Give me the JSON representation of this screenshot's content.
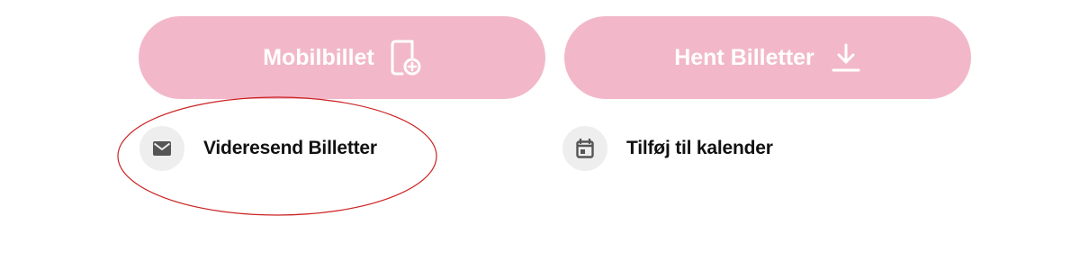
{
  "buttons": {
    "mobilbillet": {
      "label": "Mobilbillet",
      "icon": "mobile-ticket-add-icon"
    },
    "hent_billetter": {
      "label": "Hent Billetter",
      "icon": "download-icon"
    }
  },
  "actions": {
    "videresend": {
      "label": "Videresend Billetter",
      "icon": "envelope-icon"
    },
    "kalender": {
      "label": "Tilføj til kalender",
      "icon": "calendar-icon"
    }
  },
  "annotation": {
    "shape": "ellipse",
    "target": "videresend",
    "color": "#cc2222"
  },
  "colors": {
    "button_background": "#f2b8c9",
    "button_text": "#ffffff",
    "icon_circle": "#eeeeee",
    "icon_glyph": "#555555",
    "label_text": "#111111"
  }
}
